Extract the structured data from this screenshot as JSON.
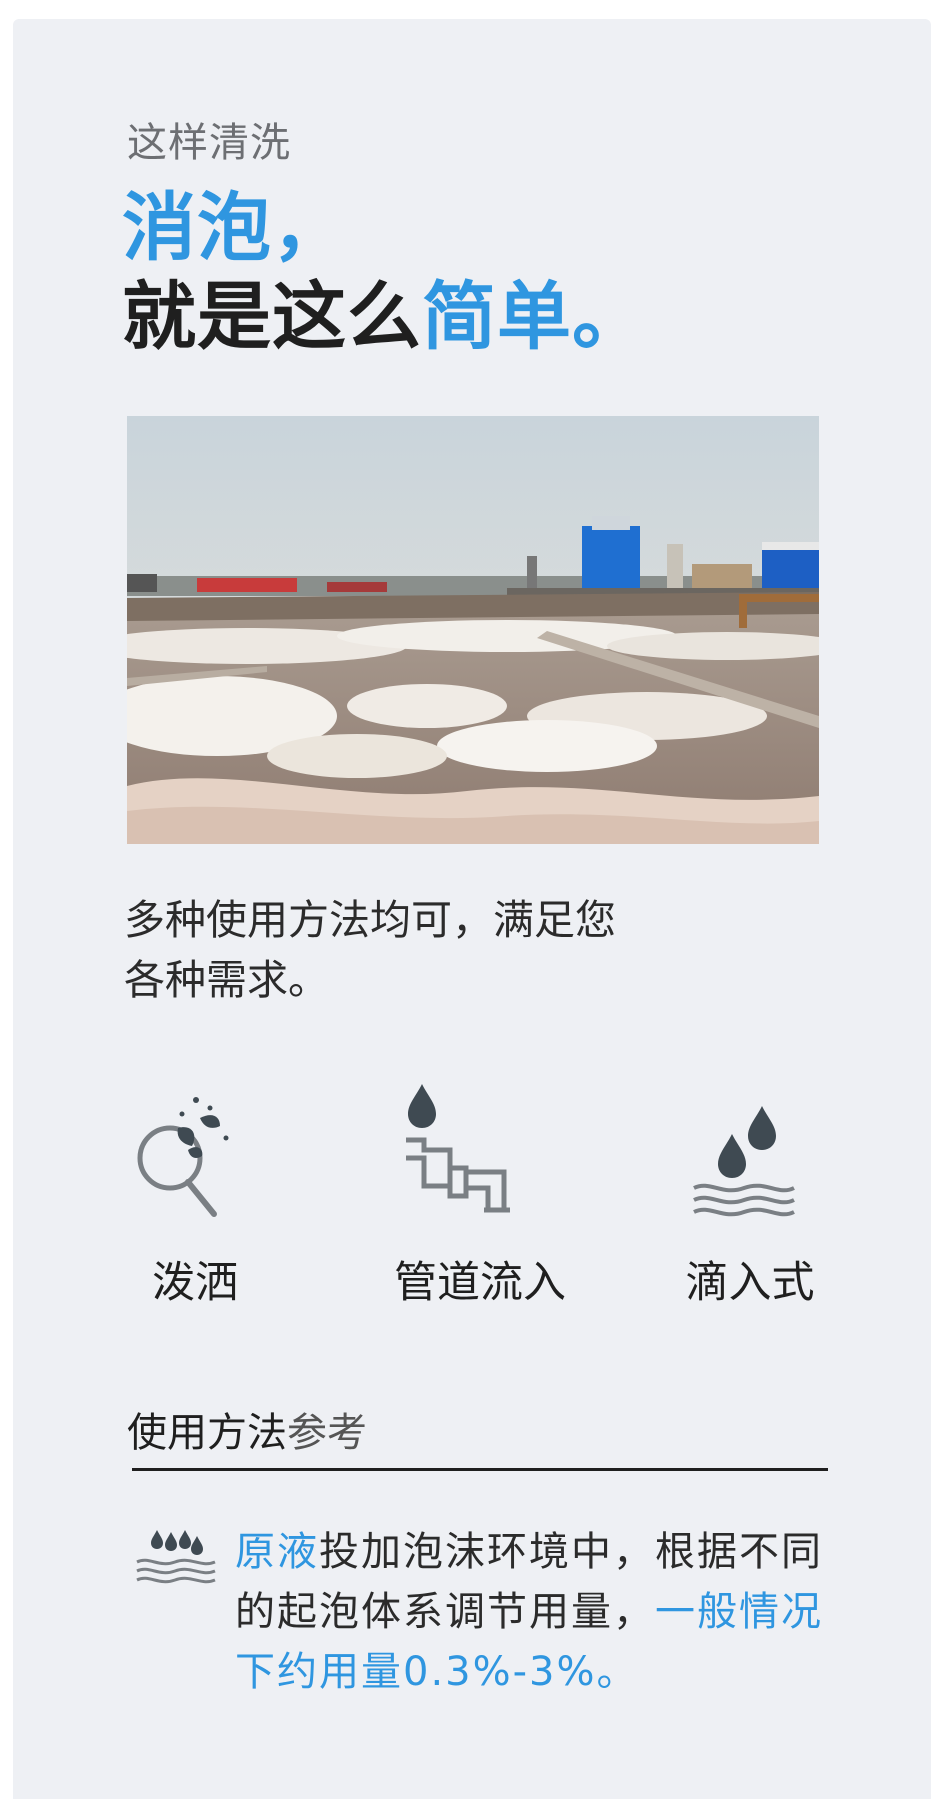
{
  "header": {
    "kicker": "这样清洗",
    "title_line1": "消泡，",
    "title_line2_dark": "就是这么",
    "title_line2_accent": "简单。"
  },
  "intro": {
    "line1": "多种使用方法均可，满足您",
    "line2": "各种需求。"
  },
  "methods": [
    {
      "label": "泼洒",
      "icon": "splash-icon"
    },
    {
      "label": "管道流入",
      "icon": "pipe-drop-icon"
    },
    {
      "label": "滴入式",
      "icon": "drip-water-icon"
    }
  ],
  "reference": {
    "title_dark": "使用方法",
    "title_light": "参考",
    "icon": "rain-water-icon",
    "seg1_accent": "原液",
    "seg2": "投加泡沫环境中，根据不同的起泡体系调节用量，",
    "seg3_accent": "一般情况下约用量0.3%-3%。"
  },
  "colors": {
    "accent": "#2f96e0",
    "text_dark": "#1f1f1f",
    "background": "#eef0f4"
  }
}
